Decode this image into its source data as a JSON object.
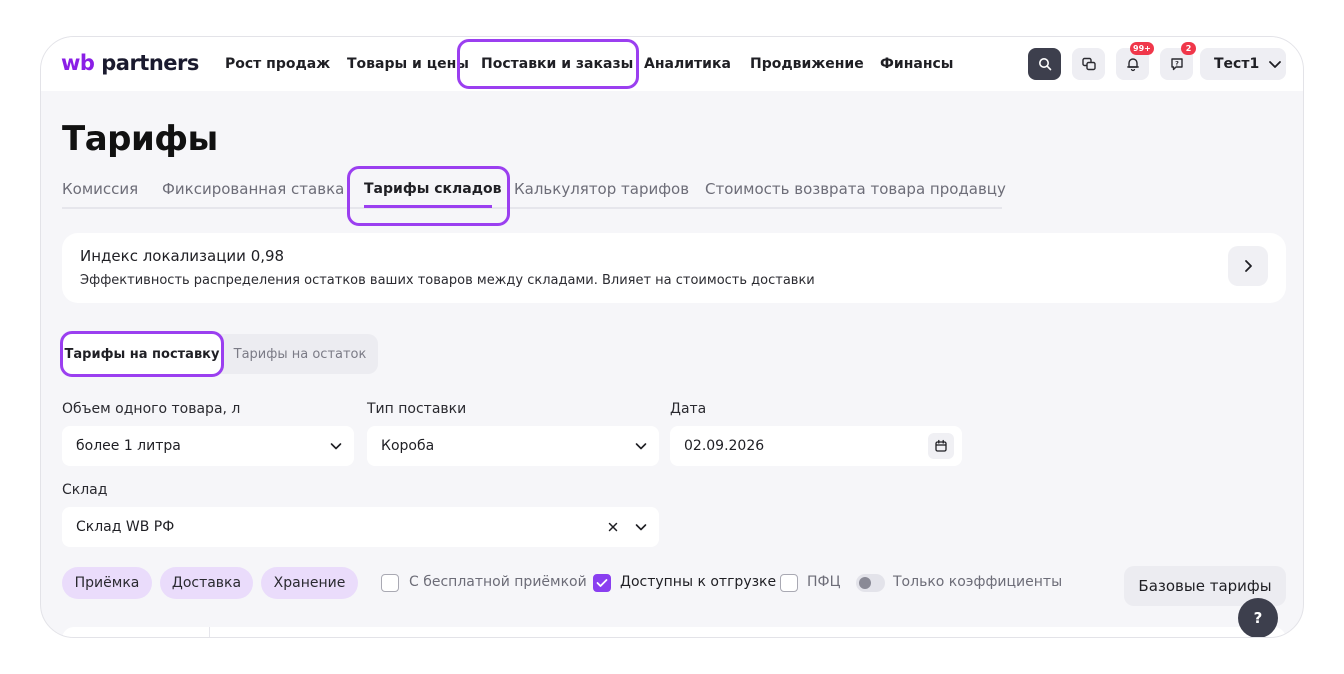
{
  "header": {
    "logo_wb": "wb",
    "logo_partners": "partners",
    "nav": [
      "Рост продаж",
      "Товары и цены",
      "Поставки и заказы",
      "Аналитика",
      "Продвижение",
      "Финансы"
    ],
    "notifications_badge": "99+",
    "support_badge": "2",
    "user_name": "Тест1"
  },
  "page": {
    "title": "Тарифы",
    "tabs": [
      "Комиссия",
      "Фиксированная ставка",
      "Тарифы складов",
      "Калькулятор тарифов",
      "Стоимость возврата товара продавцу"
    ],
    "active_tab": "Тарифы складов"
  },
  "localization_card": {
    "title": "Индекс локализации 0,98",
    "description": "Эффективность распределения остатков ваших товаров между складами. Влияет на стоимость доставки"
  },
  "segment": {
    "options": [
      "Тарифы на поставку",
      "Тарифы на остаток"
    ],
    "selected": "Тарифы на поставку"
  },
  "filters": {
    "volume": {
      "label": "Объем одного товара, л",
      "value": "более 1 литра"
    },
    "supply_type": {
      "label": "Тип поставки",
      "value": "Короба"
    },
    "date": {
      "label": "Дата",
      "value": "02.09.2026"
    },
    "warehouse": {
      "label": "Склад",
      "value": "Склад WB РФ"
    }
  },
  "chips": [
    "Приёмка",
    "Доставка",
    "Хранение"
  ],
  "checkboxes": [
    {
      "label": "С бесплатной приёмкой",
      "checked": false
    },
    {
      "label": "Доступны к отгрузке",
      "checked": true
    },
    {
      "label": "ПФЦ",
      "checked": false
    }
  ],
  "toggle": {
    "label": "Только коэффициенты",
    "on": false
  },
  "base_tariffs_button": "Базовые тарифы",
  "help_button": "?",
  "colors": {
    "accent": "#9b3ff0",
    "chip_bg": "#eadcfb",
    "badge": "#f0374a",
    "dark_button": "#3d3f4d"
  }
}
